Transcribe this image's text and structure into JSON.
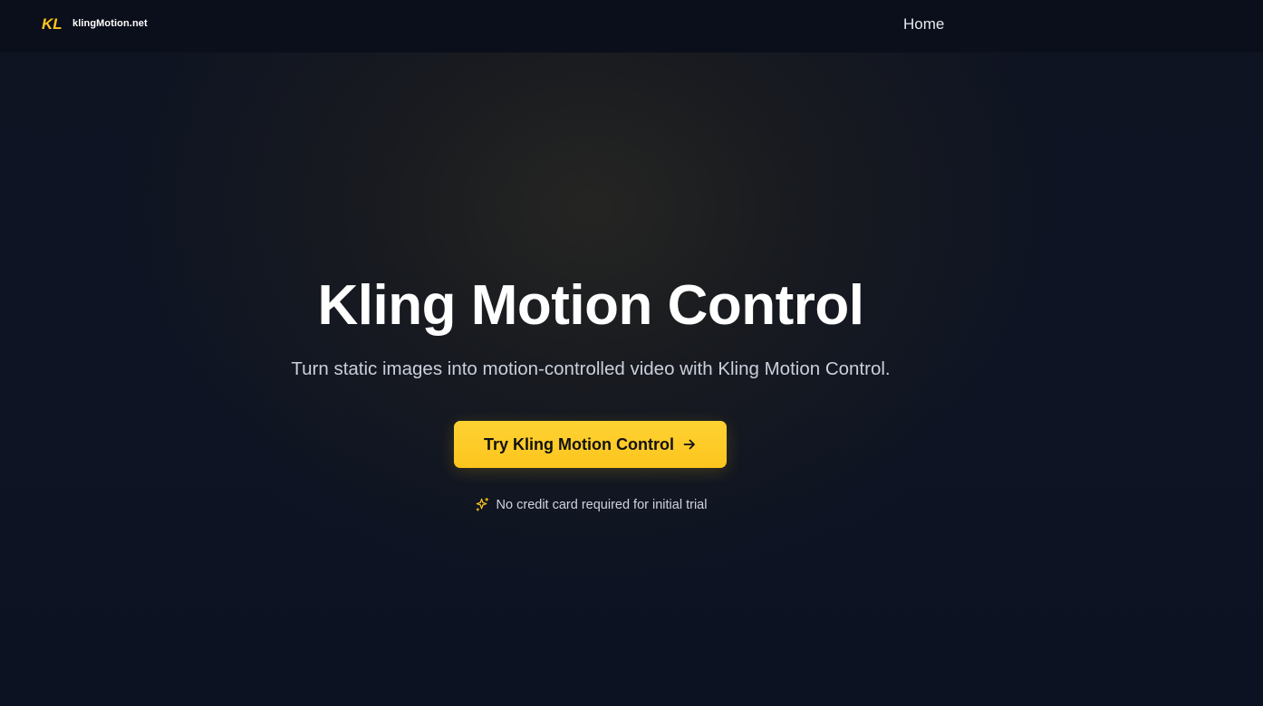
{
  "nav": {
    "brand_text": "klingMotion.net",
    "logo_mark": "KL",
    "home_label": "Home"
  },
  "hero": {
    "title": "Kling Motion Control",
    "subtitle": "Turn static images into motion-controlled video with Kling Motion Control.",
    "cta_label": "Try Kling Motion Control",
    "cta_icon": "arrow-right-icon",
    "note_icon": "sparkles-icon",
    "note": "No credit card required for initial trial"
  },
  "colors": {
    "accent": "#fcc51d",
    "background": "#0d1220",
    "navbar": "#0b0f1b"
  }
}
